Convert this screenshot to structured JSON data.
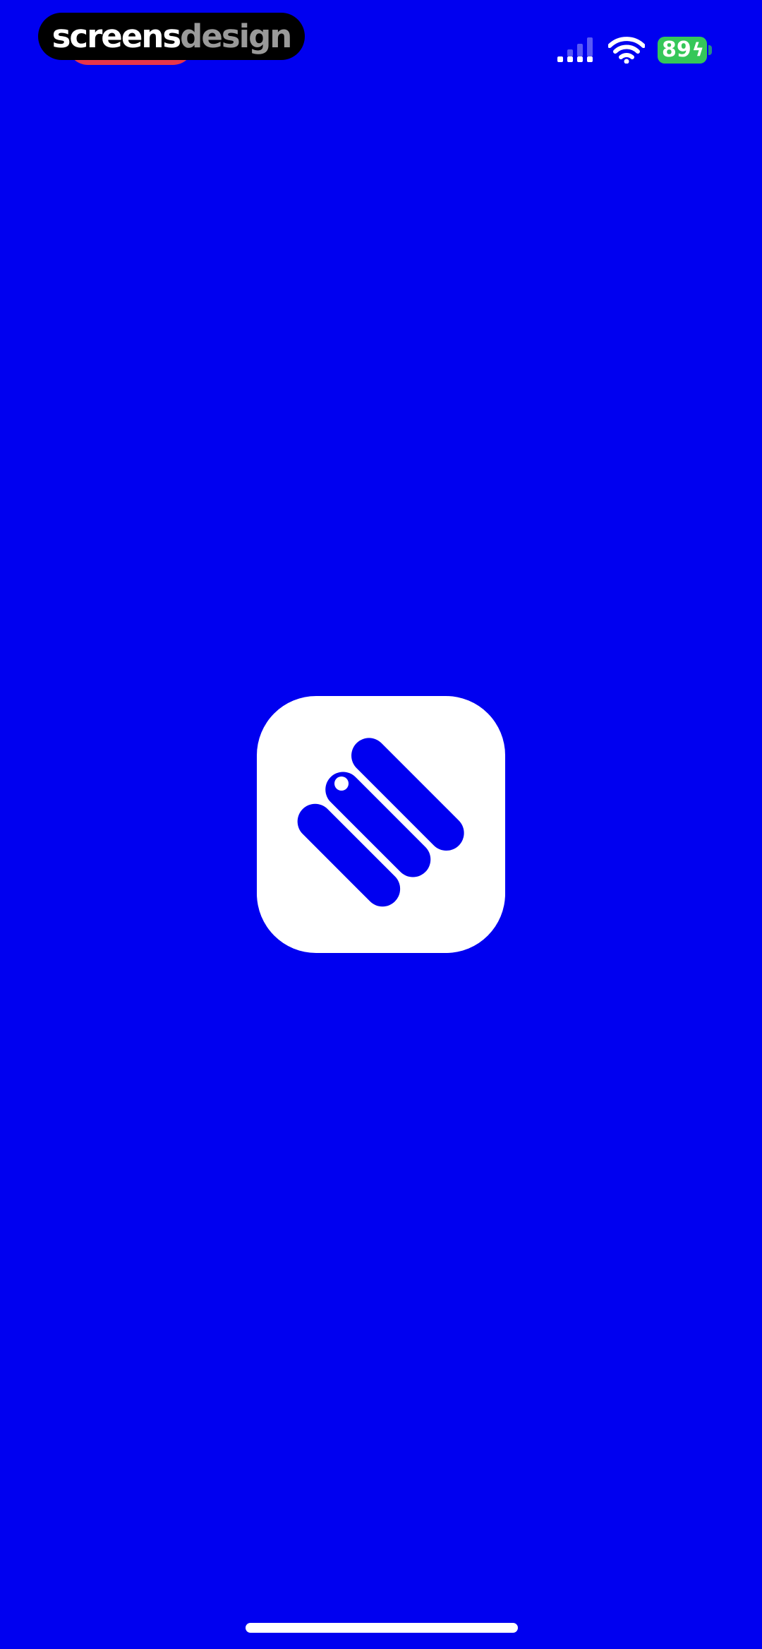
{
  "colors": {
    "background": "#0000f0",
    "accent": "#ffffff",
    "battery_fill": "#35c759",
    "recording_indicator": "#e8354a"
  },
  "watermark": {
    "part1": "screens",
    "part2": "design"
  },
  "status_bar": {
    "battery_level": "89",
    "battery_charging": true,
    "icons": [
      "signal-icon",
      "wifi-icon",
      "battery-icon"
    ]
  },
  "app_icon": {
    "icon": "app-logo-icon"
  }
}
